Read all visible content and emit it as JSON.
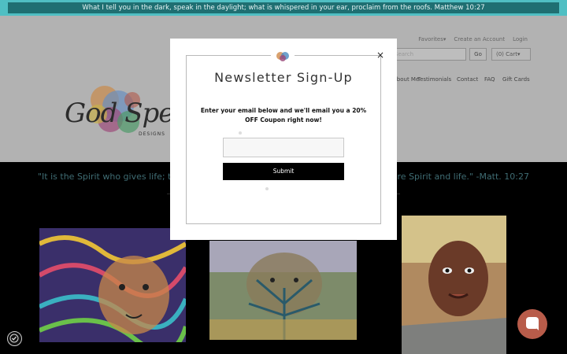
{
  "announcement": "What I tell you in the dark, speak in the daylight; what is whispered in your ear, proclaim from the roofs. Matthew 10:27",
  "header": {
    "top_links": [
      "Favorites▾",
      "Create an Account",
      "Login"
    ],
    "search_placeholder": "Search",
    "go_label": "Go",
    "cart_label": "(0) Cart▾",
    "nav": [
      "About Me",
      "Testimonials",
      "Contact",
      "FAQ",
      "Gift Cards"
    ],
    "logo_text": "God Speak",
    "logo_sub": "DESIGNS"
  },
  "quote": {
    "left": "\"It is the Spirit who gives life; the",
    "right": "you are Spirit and life.\" -Matt. 10:27"
  },
  "modal": {
    "title": "Newsletter Sign-Up",
    "text": "Enter your email below and we'll email you a 20% OFF Coupon right now!",
    "email_value": "",
    "submit_label": "Submit",
    "close_label": "×"
  },
  "colors": {
    "announce_outer": "#4fbfc3",
    "announce_inner": "#1f6f72",
    "chat_button": "#b85c4a"
  },
  "icons": [
    "cart-icon",
    "close-icon",
    "chat-icon",
    "accessibility-icon"
  ]
}
